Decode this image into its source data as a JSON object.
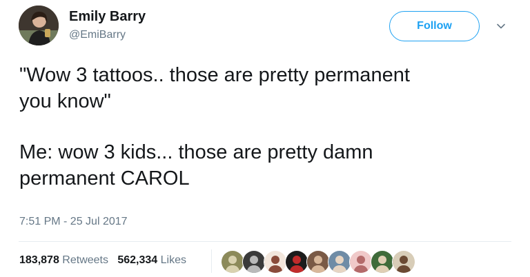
{
  "author": {
    "display_name": "Emily Barry",
    "handle": "@EmiBarry",
    "avatar_icon": "profile-photo-icon"
  },
  "actions": {
    "follow_label": "Follow",
    "menu_icon": "chevron-down-icon"
  },
  "tweet": {
    "paragraphs": [
      [
        "\"Wow 3 tattoos.. those are pretty permanent",
        "you know\""
      ],
      [
        "Me: wow 3 kids... those are pretty damn",
        "permanent CAROL"
      ]
    ],
    "timestamp": "7:51 PM - 25 Jul 2017"
  },
  "stats": {
    "retweets_count": "183,878",
    "retweets_label": "Retweets",
    "likes_count": "562,334",
    "likes_label": "Likes"
  },
  "likers": [
    {
      "bg": "#8c8a5a",
      "fg": "#d9d2b0"
    },
    {
      "bg": "#3a3a3a",
      "fg": "#b9b9b9"
    },
    {
      "bg": "#f2e6dc",
      "fg": "#8a4b3a"
    },
    {
      "bg": "#1c1c1c",
      "fg": "#c22b2b"
    },
    {
      "bg": "#7a5a46",
      "fg": "#d8b79a"
    },
    {
      "bg": "#6f8ca6",
      "fg": "#e7d5c3"
    },
    {
      "bg": "#f0c9c9",
      "fg": "#b46a6a"
    },
    {
      "bg": "#3f6b3a",
      "fg": "#e0cfb5"
    },
    {
      "bg": "#d8cdb8",
      "fg": "#6b4a33"
    }
  ],
  "colors": {
    "accent": "#1da1f2",
    "text": "#14171a",
    "secondary": "#657786",
    "divider": "#e6ecf0"
  }
}
